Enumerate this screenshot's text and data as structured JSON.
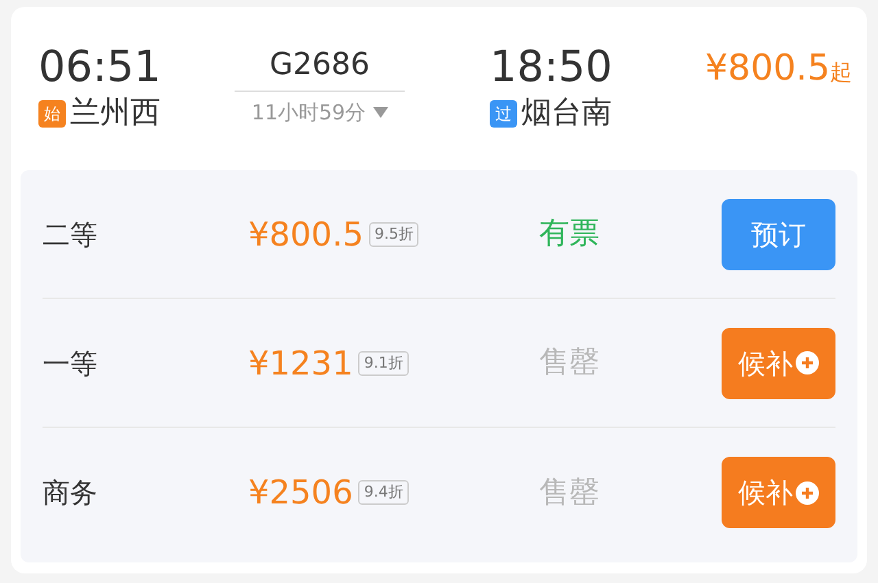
{
  "train": {
    "departure_time": "06:51",
    "departure_station": {
      "badge": "始",
      "color": "#f5821f",
      "name": "兰州西"
    },
    "number": "G2686",
    "duration": "11小时59分",
    "arrival_time": "18:50",
    "arrival_station": {
      "badge": "过",
      "color": "#3a95f5",
      "name": "烟台南"
    },
    "lowest_price": "¥800.5",
    "price_suffix": "起"
  },
  "seats": [
    {
      "class": "二等",
      "price": "¥800.5",
      "discount": "9.5折",
      "status": "有票",
      "kind": "available",
      "button": {
        "kind": "book",
        "label": "预订"
      }
    },
    {
      "class": "一等",
      "price": "¥1231",
      "discount": "9.1折",
      "status": "售罄",
      "kind": "sold_out",
      "button": {
        "kind": "waitlist",
        "label": "候补"
      }
    },
    {
      "class": "商务",
      "price": "¥2506",
      "discount": "9.4折",
      "status": "售罄",
      "kind": "sold_out",
      "button": {
        "kind": "waitlist",
        "label": "候补"
      }
    }
  ]
}
